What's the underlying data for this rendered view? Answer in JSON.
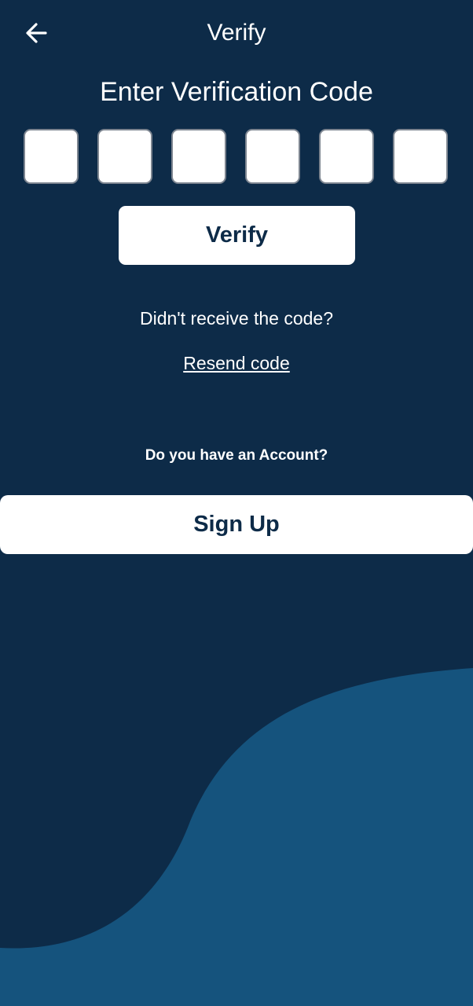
{
  "header": {
    "title": "Verify",
    "back_icon": "arrow-left-icon"
  },
  "main": {
    "heading": "Enter Verification Code",
    "code_digits": [
      "",
      "",
      "",
      "",
      "",
      ""
    ],
    "verify_label": "Verify",
    "didnt_receive": "Didn't receive the code?",
    "resend_label": "Resend code"
  },
  "footer": {
    "account_question": "Do you have an Account?",
    "signup_label": "Sign Up"
  },
  "colors": {
    "background": "#0d2b48",
    "wave": "#15537d",
    "button_background": "#ffffff",
    "button_text": "#0d2b48"
  }
}
